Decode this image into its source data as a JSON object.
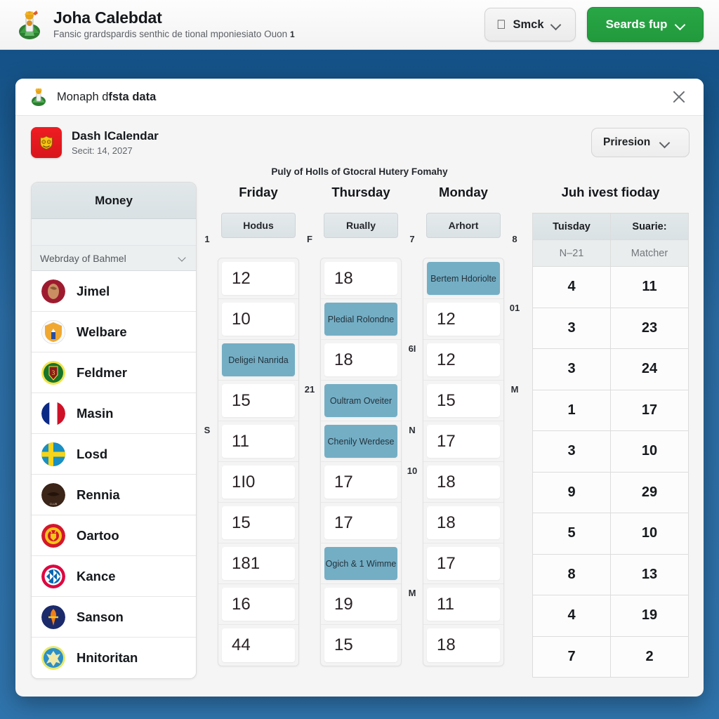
{
  "appbar": {
    "title": "Joha Calebdat",
    "subtitle": "Fansic grardspardis senthic de tional mponiesiato Ouon",
    "subtitle_sup": "1",
    "crest_icon": "heraldic-crest-icon",
    "apple_icon": "apple-logo-icon",
    "menu_button": "Smck",
    "primary_button": "Seards fup",
    "chevron_icon": "chevron-down-icon"
  },
  "dialog": {
    "crest_icon": "heraldic-crest-icon",
    "title_prefix": "Monaph d",
    "title_bold": "fsta data",
    "close_icon": "close-icon",
    "subheader": {
      "badge_icon": "red-shield-badge-icon",
      "title": "Dash lCalendar",
      "date": "Secit: 14, 2027",
      "select_label": "Priresion",
      "select_chevron": "chevron-down-icon"
    },
    "board_caption": "Puly of Holls of Gtocral Hutery Fomahy"
  },
  "left_panel": {
    "title": "Money",
    "select_value": "Webrday of Bahmel",
    "select_chevron": "chevron-down-icon",
    "rows": [
      {
        "name": "Jimel",
        "crest": "crest-red-circle"
      },
      {
        "name": "Welbare",
        "crest": "crest-white-shield"
      },
      {
        "name": "Feldmer",
        "crest": "crest-green-circle"
      },
      {
        "name": "Masin",
        "crest": "crest-france-tricolor"
      },
      {
        "name": "Losd",
        "crest": "crest-sweden-cross"
      },
      {
        "name": "Rennia",
        "crest": "crest-dark-brown"
      },
      {
        "name": "Oartoo",
        "crest": "crest-red-devil"
      },
      {
        "name": "Kance",
        "crest": "crest-bavaria-lozenge"
      },
      {
        "name": "Sanson",
        "crest": "crest-navy-orange"
      },
      {
        "name": "Hnitoritan",
        "crest": "crest-blue-yellow"
      }
    ]
  },
  "gutters": [
    {
      "marks": [
        {
          "label": "S",
          "row": 3
        }
      ]
    },
    {
      "marks": [
        {
          "label": "21",
          "row": 2
        }
      ]
    },
    {
      "marks": [
        {
          "label": "6I",
          "row": 1
        },
        {
          "label": "N",
          "row": 3
        },
        {
          "label": "10",
          "row": 4
        },
        {
          "label": "M",
          "row": 7
        }
      ]
    },
    {
      "marks": [
        {
          "label": "01",
          "row": 0
        },
        {
          "label": "M",
          "row": 2
        }
      ]
    }
  ],
  "day_columns": [
    {
      "header": "Friday",
      "chip": "Hodus",
      "chip_marker": "1",
      "cells": [
        {
          "text": "12",
          "highlight": false
        },
        {
          "text": "10",
          "highlight": false
        },
        {
          "text": "Deligei Nanrida",
          "highlight": true
        },
        {
          "text": "15",
          "highlight": false
        },
        {
          "text": "11",
          "highlight": false
        },
        {
          "text": "1I0",
          "highlight": false
        },
        {
          "text": "15",
          "highlight": false
        },
        {
          "text": "181",
          "highlight": false
        },
        {
          "text": "16",
          "highlight": false
        },
        {
          "text": "44",
          "highlight": false
        }
      ]
    },
    {
      "header": "Thursday",
      "chip": "Rually",
      "chip_marker": "F",
      "cells": [
        {
          "text": "18",
          "highlight": false
        },
        {
          "text": "Pledial Rolondne",
          "highlight": true
        },
        {
          "text": "18",
          "highlight": false
        },
        {
          "text": "Oultram Oveiter",
          "highlight": true
        },
        {
          "text": "Chenily Werdese",
          "highlight": true
        },
        {
          "text": "17",
          "highlight": false
        },
        {
          "text": "17",
          "highlight": false
        },
        {
          "text": "Ogich & 1 Wimme",
          "highlight": true
        },
        {
          "text": "19",
          "highlight": false
        },
        {
          "text": "15",
          "highlight": false
        }
      ]
    },
    {
      "header": "Monday",
      "chip": "Arhort",
      "chip_marker": "7",
      "cells": [
        {
          "text": "Bertem Hdoriolte",
          "highlight": true
        },
        {
          "text": "12",
          "highlight": false
        },
        {
          "text": "12",
          "highlight": false
        },
        {
          "text": "15",
          "highlight": false
        },
        {
          "text": "17",
          "highlight": false
        },
        {
          "text": "18",
          "highlight": false
        },
        {
          "text": "18",
          "highlight": false
        },
        {
          "text": "17",
          "highlight": false
        },
        {
          "text": "11",
          "highlight": false
        },
        {
          "text": "18",
          "highlight": false
        }
      ]
    }
  ],
  "right_table": {
    "title": "Juh ivest fioday",
    "marker": "8",
    "headers": [
      "Tuisday",
      "Suarie:"
    ],
    "subheaders": [
      "N–21",
      "Matcher"
    ],
    "rows": [
      [
        "4",
        "11"
      ],
      [
        "3",
        "23"
      ],
      [
        "3",
        "24"
      ],
      [
        "1",
        "17"
      ],
      [
        "3",
        "10"
      ],
      [
        "9",
        "29"
      ],
      [
        "5",
        "10"
      ],
      [
        "8",
        "13"
      ],
      [
        "4",
        "19"
      ],
      [
        "7",
        "2"
      ]
    ]
  }
}
